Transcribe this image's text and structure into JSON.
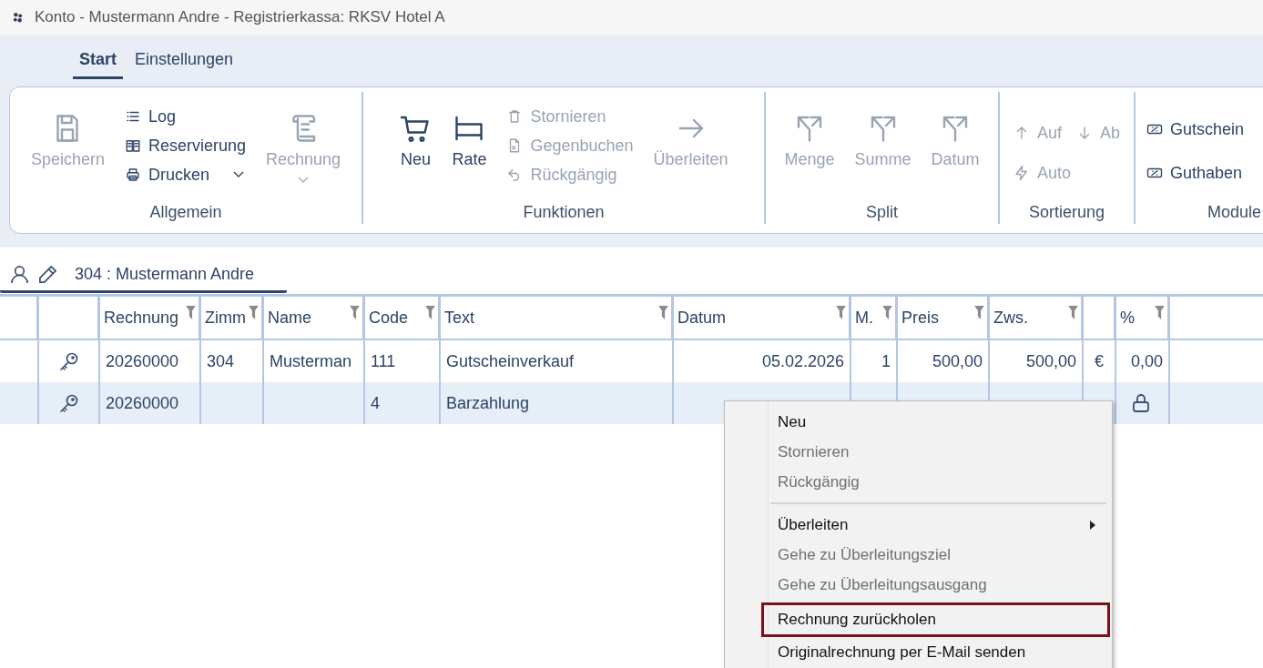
{
  "window": {
    "title": "Konto - Mustermann Andre - Registrierkassa: RKSV Hotel A"
  },
  "tabs": [
    {
      "label": "Start",
      "selected": true
    },
    {
      "label": "Einstellungen",
      "selected": false
    }
  ],
  "ribbon": {
    "groups": [
      {
        "label": "Allgemein",
        "items": [
          {
            "kind": "large",
            "label": "Speichern",
            "disabled": true,
            "dropdown": false
          },
          {
            "kind": "stack",
            "rows": [
              [
                {
                  "label": "Log",
                  "disabled": false,
                  "dropdown": false
                }
              ],
              [
                {
                  "label": "Reservierung",
                  "disabled": false,
                  "dropdown": false
                }
              ],
              [
                {
                  "label": "Drucken",
                  "disabled": false,
                  "dropdown": true
                }
              ]
            ]
          },
          {
            "kind": "large",
            "label": "Rechnung",
            "disabled": true,
            "dropdown": true
          }
        ]
      },
      {
        "label": "Funktionen",
        "items": [
          {
            "kind": "large",
            "label": "Neu",
            "disabled": false,
            "dropdown": false
          },
          {
            "kind": "large",
            "label": "Rate",
            "disabled": false,
            "dropdown": false
          },
          {
            "kind": "stack",
            "rows": [
              [
                {
                  "label": "Stornieren",
                  "disabled": true,
                  "dropdown": false
                }
              ],
              [
                {
                  "label": "Gegenbuchen",
                  "disabled": true,
                  "dropdown": false
                }
              ],
              [
                {
                  "label": "Rückgängig",
                  "disabled": true,
                  "dropdown": false
                }
              ]
            ]
          },
          {
            "kind": "large",
            "label": "Überleiten",
            "disabled": true,
            "dropdown": false
          }
        ]
      },
      {
        "label": "Split",
        "items": [
          {
            "kind": "large",
            "label": "Menge",
            "disabled": true,
            "dropdown": false
          },
          {
            "kind": "large",
            "label": "Summe",
            "disabled": true,
            "dropdown": false
          },
          {
            "kind": "large",
            "label": "Datum",
            "disabled": true,
            "dropdown": false
          }
        ]
      },
      {
        "label": "Sortierung",
        "items": [
          {
            "kind": "stack",
            "rows": [
              [
                {
                  "label": "Auf",
                  "disabled": true,
                  "dropdown": false
                },
                {
                  "label": "Ab",
                  "disabled": true,
                  "dropdown": false
                }
              ],
              [
                {
                  "label": "Auto",
                  "disabled": true,
                  "dropdown": false
                }
              ]
            ]
          }
        ]
      },
      {
        "label": "Module",
        "items": [
          {
            "kind": "stack",
            "rows": [
              [
                {
                  "label": "Gutschein",
                  "disabled": false,
                  "dropdown": false
                }
              ],
              [
                {
                  "label": "Guthaben",
                  "disabled": false,
                  "dropdown": false
                }
              ]
            ]
          }
        ]
      }
    ]
  },
  "account_tab": {
    "label": "304 :  Mustermann Andre",
    "selected": true
  },
  "table": {
    "columns": [
      {
        "filter": false
      },
      {
        "filter": false
      },
      {
        "label": "Rechnung",
        "filter": true
      },
      {
        "label": "Zimm",
        "filter": true
      },
      {
        "label": "Name",
        "filter": true
      },
      {
        "label": "Code",
        "filter": true
      },
      {
        "label": "Text",
        "filter": true
      },
      {
        "label": "Datum",
        "filter": true
      },
      {
        "label": "M.",
        "filter": true
      },
      {
        "label": "Preis",
        "filter": true
      },
      {
        "label": "Zws.",
        "filter": true
      },
      {
        "filter": false
      },
      {
        "label": "%",
        "filter": true
      }
    ],
    "rows": [
      {
        "selected": false,
        "locked": false,
        "cells": [
          null,
          null,
          "20260000",
          "304",
          "Musterman",
          "111",
          "Gutscheinverkauf",
          "05.02.2026",
          "1",
          "500,00",
          "500,00",
          "€",
          "0,00"
        ]
      },
      {
        "selected": true,
        "locked": true,
        "cells": [
          null,
          null,
          "20260000",
          null,
          null,
          "4",
          "Barzahlung",
          null,
          null,
          null,
          null,
          null,
          null
        ]
      }
    ]
  },
  "context_menu": {
    "items": [
      {
        "label": "Neu",
        "disabled": false,
        "separator_before": false,
        "submenu": false,
        "highlighted": false
      },
      {
        "label": "Stornieren",
        "disabled": true,
        "separator_before": false,
        "submenu": false,
        "highlighted": false
      },
      {
        "label": "Rückgängig",
        "disabled": true,
        "separator_before": false,
        "submenu": false,
        "highlighted": false
      },
      {
        "label": "Überleiten",
        "disabled": false,
        "separator_before": true,
        "submenu": true,
        "highlighted": false
      },
      {
        "label": "Gehe zu Überleitungsziel",
        "disabled": true,
        "separator_before": false,
        "submenu": false,
        "highlighted": false
      },
      {
        "label": "Gehe zu Überleitungsausgang",
        "disabled": true,
        "separator_before": false,
        "submenu": false,
        "highlighted": false
      },
      {
        "label": "Rechnung zurückholen",
        "disabled": false,
        "separator_before": false,
        "submenu": false,
        "highlighted": true
      },
      {
        "label": "Originalrechnung per E-Mail senden",
        "disabled": false,
        "separator_before": false,
        "submenu": false,
        "highlighted": false
      }
    ]
  }
}
